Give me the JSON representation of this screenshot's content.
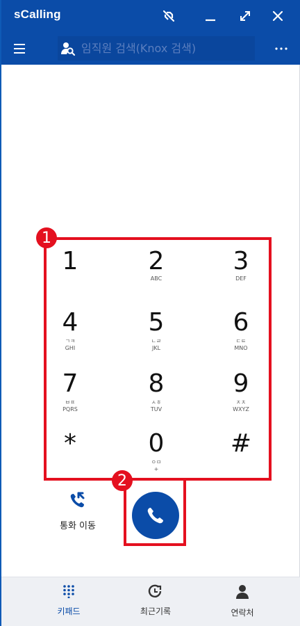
{
  "app": {
    "title": "sCalling"
  },
  "search": {
    "placeholder": "임직원 검색(Knox 검색)"
  },
  "keypad": {
    "keys": [
      {
        "digit": "1",
        "letters": "",
        "korean": ""
      },
      {
        "digit": "2",
        "letters": "ABC",
        "korean": ""
      },
      {
        "digit": "3",
        "letters": "DEF",
        "korean": ""
      },
      {
        "digit": "4",
        "letters": "GHI",
        "korean": "ㄱㅋ"
      },
      {
        "digit": "5",
        "letters": "JKL",
        "korean": "ㄴㄹ"
      },
      {
        "digit": "6",
        "letters": "MNO",
        "korean": "ㄷㅌ"
      },
      {
        "digit": "7",
        "letters": "PQRS",
        "korean": "ㅂㅍ"
      },
      {
        "digit": "8",
        "letters": "TUV",
        "korean": "ㅅㅎ"
      },
      {
        "digit": "9",
        "letters": "WXYZ",
        "korean": "ㅈㅊ"
      },
      {
        "digit": "*",
        "letters": "",
        "korean": ""
      },
      {
        "digit": "0",
        "letters": "+",
        "korean": "ㅇㅁ"
      },
      {
        "digit": "#",
        "letters": "",
        "korean": ""
      }
    ]
  },
  "annotations": {
    "keypad_number": "1",
    "call_number": "2"
  },
  "transfer": {
    "label": "통화 이동"
  },
  "nav": {
    "keypad_label": "키패드",
    "recent_label": "최근기록",
    "contacts_label": "연락처"
  },
  "colors": {
    "primary": "#0b4ca8",
    "annotation": "#e4101f"
  }
}
